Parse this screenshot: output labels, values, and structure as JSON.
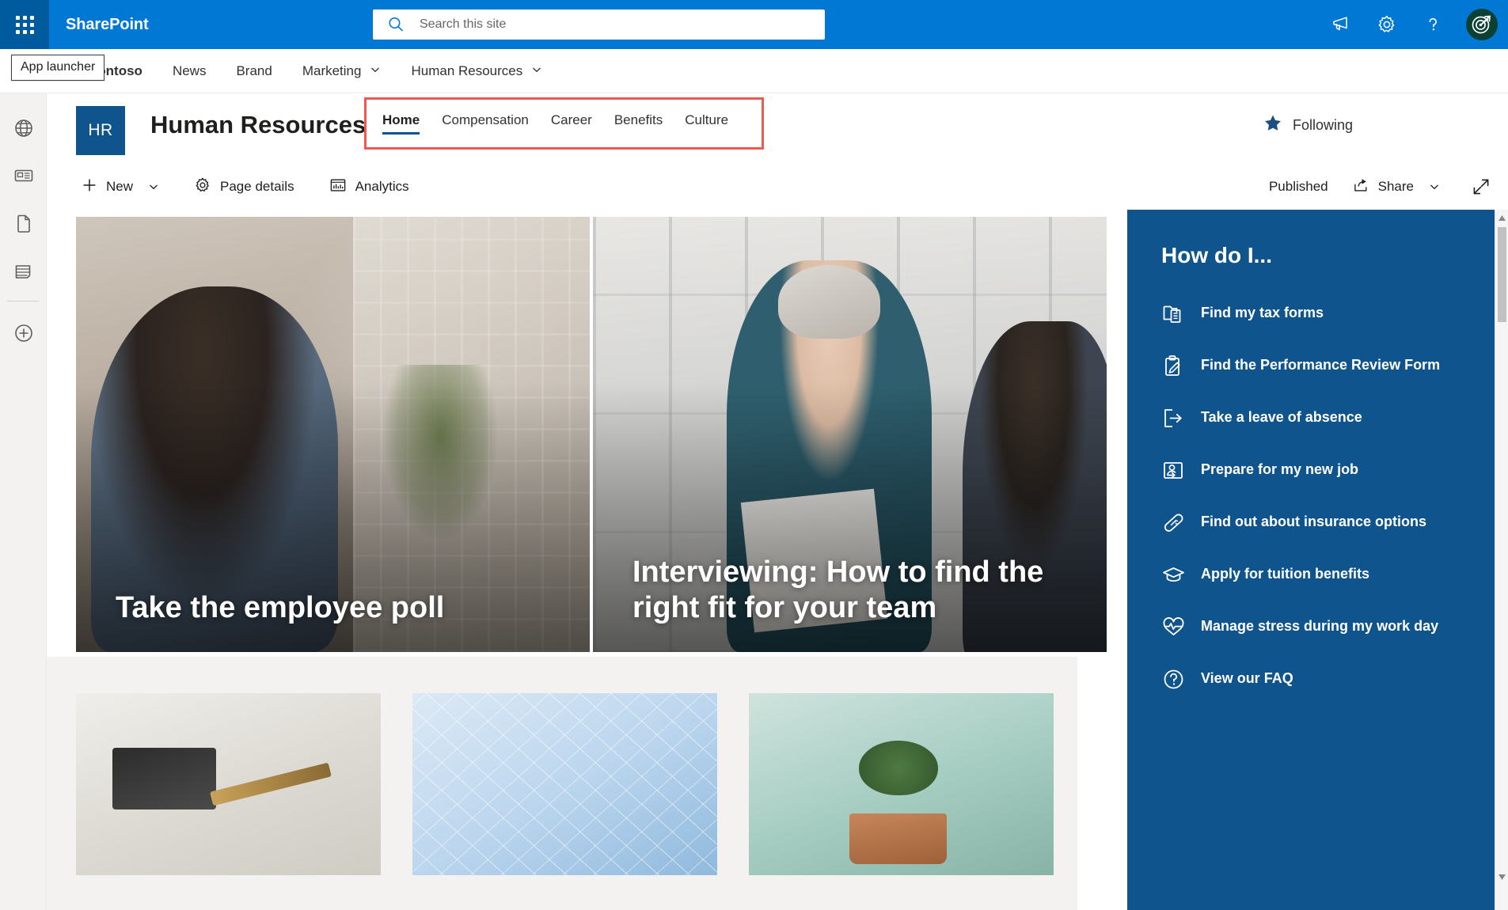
{
  "suite": {
    "brand": "SharePoint",
    "app_launcher_tooltip": "App launcher",
    "search_placeholder": "Search this site",
    "icons": {
      "waffle": "app-launcher-icon",
      "search": "search-icon",
      "megaphone": "megaphone-icon",
      "settings": "gear-icon",
      "help": "help-icon",
      "avatar": "user-avatar"
    }
  },
  "hubnav": {
    "items": [
      {
        "label": "Contoso",
        "has_chevron": false
      },
      {
        "label": "News",
        "has_chevron": false
      },
      {
        "label": "Brand",
        "has_chevron": false
      },
      {
        "label": "Marketing",
        "has_chevron": true
      },
      {
        "label": "Human Resources",
        "has_chevron": true
      }
    ]
  },
  "rail": {
    "items": [
      {
        "icon": "globe-icon"
      },
      {
        "icon": "news-icon"
      },
      {
        "icon": "page-icon"
      },
      {
        "icon": "list-icon"
      },
      {
        "icon": "add-icon"
      }
    ]
  },
  "site": {
    "logo_text": "HR",
    "title": "Human Resources",
    "following_label": "Following",
    "nav": [
      {
        "label": "Home",
        "active": true
      },
      {
        "label": "Compensation",
        "active": false
      },
      {
        "label": "Career",
        "active": false
      },
      {
        "label": "Benefits",
        "active": false
      },
      {
        "label": "Culture",
        "active": false
      }
    ],
    "highlight_color": "#f1584f"
  },
  "commandbar": {
    "new_label": "New",
    "page_details_label": "Page details",
    "analytics_label": "Analytics",
    "published_label": "Published",
    "share_label": "Share",
    "expand_icon": "expand-icon"
  },
  "hero": {
    "cards": [
      {
        "title": "Take the employee poll"
      },
      {
        "title": "Interviewing: How to find the right fit for your team"
      }
    ]
  },
  "lower_cards": [
    {
      "alt": "calculator-and-pen-image"
    },
    {
      "alt": "blue-network-image"
    },
    {
      "alt": "heart-plant-image"
    }
  ],
  "right_panel": {
    "title": "How do I...",
    "background": "#0f548c",
    "items": [
      {
        "label": "Find my tax forms",
        "icon": "tax-forms-icon"
      },
      {
        "label": "Find the Performance Review Form",
        "icon": "clipboard-edit-icon"
      },
      {
        "label": "Take a leave of absence",
        "icon": "leave-icon"
      },
      {
        "label": "Prepare for my new job",
        "icon": "new-job-icon"
      },
      {
        "label": "Find out about insurance options",
        "icon": "bandage-icon"
      },
      {
        "label": "Apply for tuition benefits",
        "icon": "graduation-cap-icon"
      },
      {
        "label": "Manage stress during my work day",
        "icon": "heartbeat-icon"
      },
      {
        "label": "View our FAQ",
        "icon": "faq-icon"
      }
    ]
  }
}
